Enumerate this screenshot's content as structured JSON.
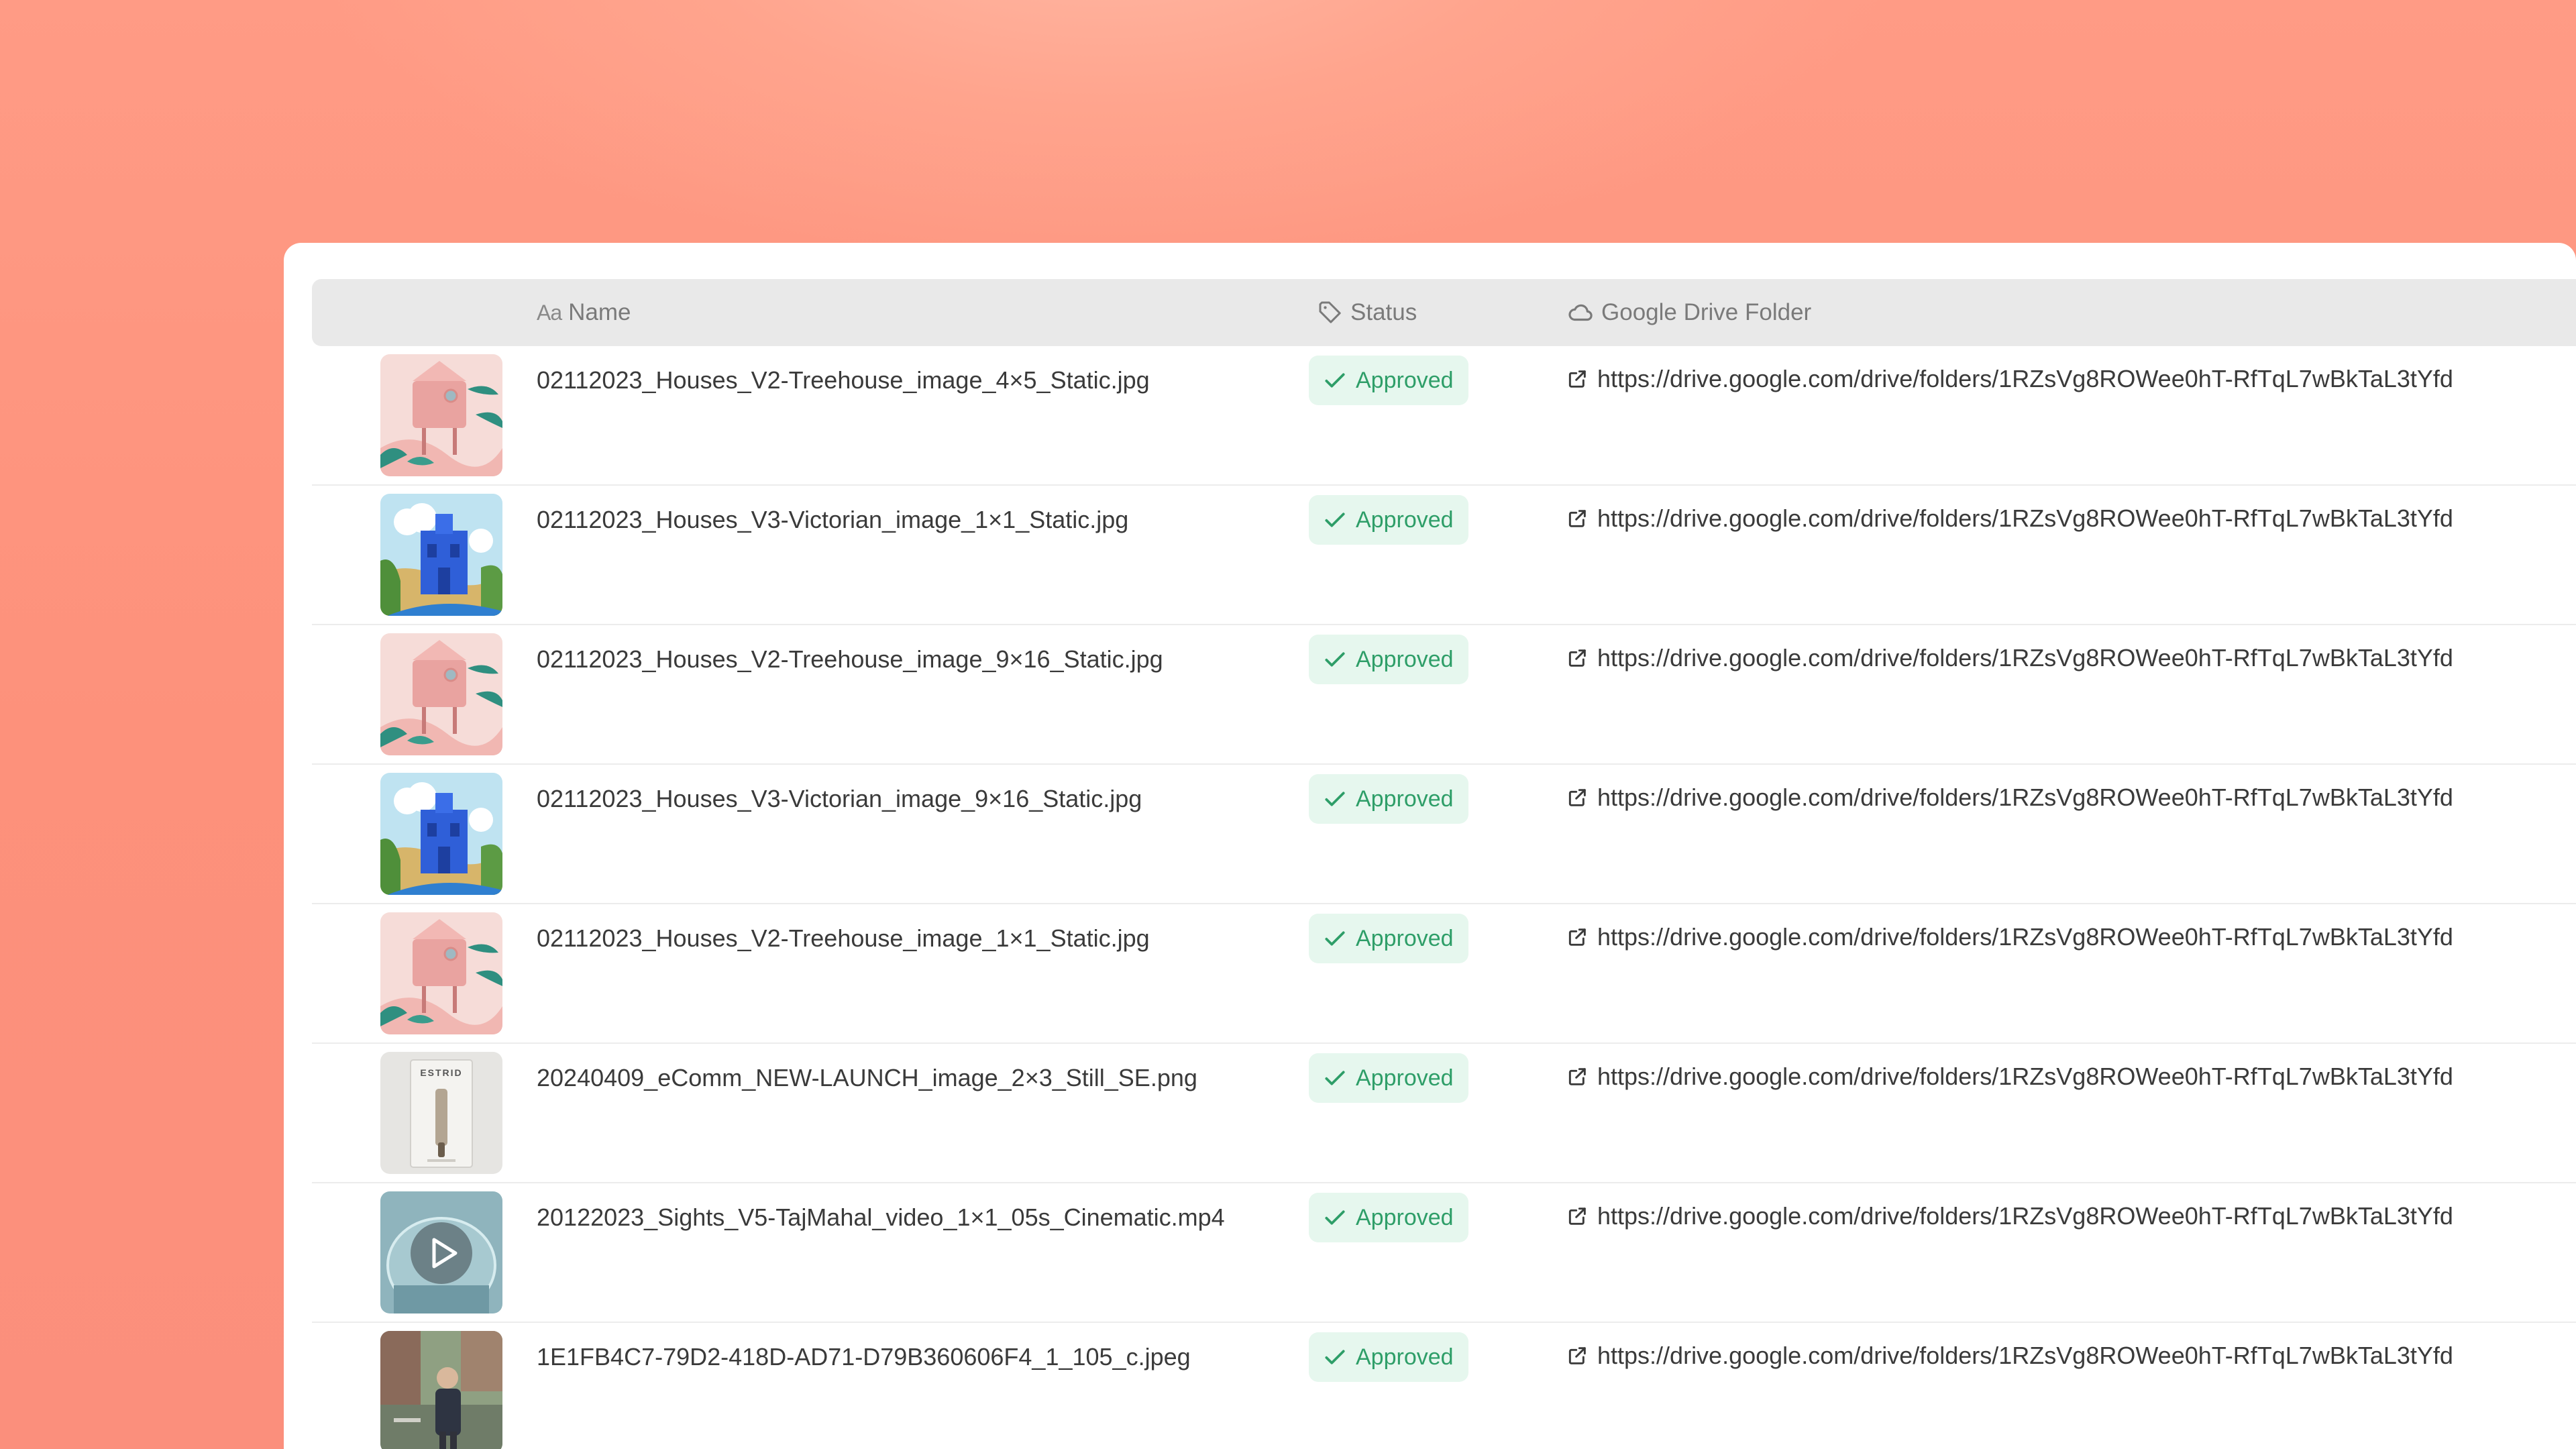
{
  "header": {
    "name_icon": "Aa",
    "name_label": "Name",
    "status_label": "Status",
    "folder_label": "Google Drive Folder",
    "icons": {
      "name": "text-type-icon",
      "status": "tag-icon",
      "folder": "cloud-icon"
    }
  },
  "colors": {
    "badge_bg": "#e6f7ee",
    "badge_text": "#2e9e68",
    "header_bg": "#e9e9e9",
    "background": "#fd917b"
  },
  "rows": [
    {
      "name": "02112023_Houses_V2-Treehouse_image_4×5_Static.jpg",
      "status": "Approved",
      "folder": "https://drive.google.com/drive/folders/1RZsVg8ROWee0hT-RfTqL7wBkTaL3tYfd",
      "thumb": "treehouse"
    },
    {
      "name": "02112023_Houses_V3-Victorian_image_1×1_Static.jpg",
      "status": "Approved",
      "folder": "https://drive.google.com/drive/folders/1RZsVg8ROWee0hT-RfTqL7wBkTaL3tYfd",
      "thumb": "victorian"
    },
    {
      "name": "02112023_Houses_V2-Treehouse_image_9×16_Static.jpg",
      "status": "Approved",
      "folder": "https://drive.google.com/drive/folders/1RZsVg8ROWee0hT-RfTqL7wBkTaL3tYfd",
      "thumb": "treehouse"
    },
    {
      "name": "02112023_Houses_V3-Victorian_image_9×16_Static.jpg",
      "status": "Approved",
      "folder": "https://drive.google.com/drive/folders/1RZsVg8ROWee0hT-RfTqL7wBkTaL3tYfd",
      "thumb": "victorian"
    },
    {
      "name": "02112023_Houses_V2-Treehouse_image_1×1_Static.jpg",
      "status": "Approved",
      "folder": "https://drive.google.com/drive/folders/1RZsVg8ROWee0hT-RfTqL7wBkTaL3tYfd",
      "thumb": "treehouse"
    },
    {
      "name": "20240409_eComm_NEW-LAUNCH_image_2×3_Still_SE.png",
      "status": "Approved",
      "folder": "https://drive.google.com/drive/folders/1RZsVg8ROWee0hT-RfTqL7wBkTaL3tYfd",
      "thumb": "product",
      "thumb_text": "ESTRID"
    },
    {
      "name": "20122023_Sights_V5-TajMahal_video_1×1_05s_Cinematic.mp4",
      "status": "Approved",
      "folder": "https://drive.google.com/drive/folders/1RZsVg8ROWee0hT-RfTqL7wBkTaL3tYfd",
      "thumb": "video"
    },
    {
      "name": "1E1FB4C7-79D2-418D-AD71-D79B360606F4_1_105_c.jpeg",
      "status": "Approved",
      "folder": "https://drive.google.com/drive/folders/1RZsVg8ROWee0hT-RfTqL7wBkTaL3tYfd",
      "thumb": "photo"
    }
  ]
}
